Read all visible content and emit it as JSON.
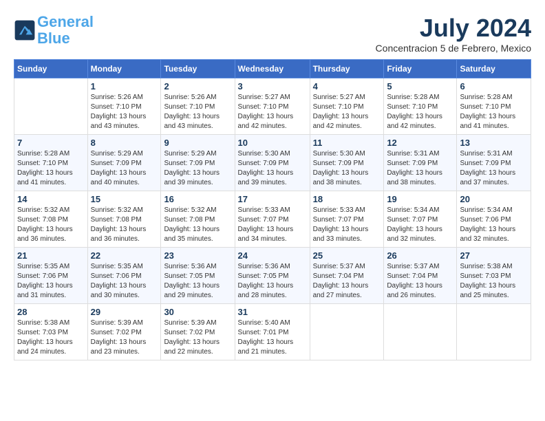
{
  "header": {
    "logo_line1": "General",
    "logo_line2": "Blue",
    "month": "July 2024",
    "location": "Concentracion 5 de Febrero, Mexico"
  },
  "days_of_week": [
    "Sunday",
    "Monday",
    "Tuesday",
    "Wednesday",
    "Thursday",
    "Friday",
    "Saturday"
  ],
  "weeks": [
    [
      {
        "day": "",
        "info": ""
      },
      {
        "day": "1",
        "info": "Sunrise: 5:26 AM\nSunset: 7:10 PM\nDaylight: 13 hours\nand 43 minutes."
      },
      {
        "day": "2",
        "info": "Sunrise: 5:26 AM\nSunset: 7:10 PM\nDaylight: 13 hours\nand 43 minutes."
      },
      {
        "day": "3",
        "info": "Sunrise: 5:27 AM\nSunset: 7:10 PM\nDaylight: 13 hours\nand 42 minutes."
      },
      {
        "day": "4",
        "info": "Sunrise: 5:27 AM\nSunset: 7:10 PM\nDaylight: 13 hours\nand 42 minutes."
      },
      {
        "day": "5",
        "info": "Sunrise: 5:28 AM\nSunset: 7:10 PM\nDaylight: 13 hours\nand 42 minutes."
      },
      {
        "day": "6",
        "info": "Sunrise: 5:28 AM\nSunset: 7:10 PM\nDaylight: 13 hours\nand 41 minutes."
      }
    ],
    [
      {
        "day": "7",
        "info": "Sunrise: 5:28 AM\nSunset: 7:10 PM\nDaylight: 13 hours\nand 41 minutes."
      },
      {
        "day": "8",
        "info": "Sunrise: 5:29 AM\nSunset: 7:09 PM\nDaylight: 13 hours\nand 40 minutes."
      },
      {
        "day": "9",
        "info": "Sunrise: 5:29 AM\nSunset: 7:09 PM\nDaylight: 13 hours\nand 39 minutes."
      },
      {
        "day": "10",
        "info": "Sunrise: 5:30 AM\nSunset: 7:09 PM\nDaylight: 13 hours\nand 39 minutes."
      },
      {
        "day": "11",
        "info": "Sunrise: 5:30 AM\nSunset: 7:09 PM\nDaylight: 13 hours\nand 38 minutes."
      },
      {
        "day": "12",
        "info": "Sunrise: 5:31 AM\nSunset: 7:09 PM\nDaylight: 13 hours\nand 38 minutes."
      },
      {
        "day": "13",
        "info": "Sunrise: 5:31 AM\nSunset: 7:09 PM\nDaylight: 13 hours\nand 37 minutes."
      }
    ],
    [
      {
        "day": "14",
        "info": "Sunrise: 5:32 AM\nSunset: 7:08 PM\nDaylight: 13 hours\nand 36 minutes."
      },
      {
        "day": "15",
        "info": "Sunrise: 5:32 AM\nSunset: 7:08 PM\nDaylight: 13 hours\nand 36 minutes."
      },
      {
        "day": "16",
        "info": "Sunrise: 5:32 AM\nSunset: 7:08 PM\nDaylight: 13 hours\nand 35 minutes."
      },
      {
        "day": "17",
        "info": "Sunrise: 5:33 AM\nSunset: 7:07 PM\nDaylight: 13 hours\nand 34 minutes."
      },
      {
        "day": "18",
        "info": "Sunrise: 5:33 AM\nSunset: 7:07 PM\nDaylight: 13 hours\nand 33 minutes."
      },
      {
        "day": "19",
        "info": "Sunrise: 5:34 AM\nSunset: 7:07 PM\nDaylight: 13 hours\nand 32 minutes."
      },
      {
        "day": "20",
        "info": "Sunrise: 5:34 AM\nSunset: 7:06 PM\nDaylight: 13 hours\nand 32 minutes."
      }
    ],
    [
      {
        "day": "21",
        "info": "Sunrise: 5:35 AM\nSunset: 7:06 PM\nDaylight: 13 hours\nand 31 minutes."
      },
      {
        "day": "22",
        "info": "Sunrise: 5:35 AM\nSunset: 7:06 PM\nDaylight: 13 hours\nand 30 minutes."
      },
      {
        "day": "23",
        "info": "Sunrise: 5:36 AM\nSunset: 7:05 PM\nDaylight: 13 hours\nand 29 minutes."
      },
      {
        "day": "24",
        "info": "Sunrise: 5:36 AM\nSunset: 7:05 PM\nDaylight: 13 hours\nand 28 minutes."
      },
      {
        "day": "25",
        "info": "Sunrise: 5:37 AM\nSunset: 7:04 PM\nDaylight: 13 hours\nand 27 minutes."
      },
      {
        "day": "26",
        "info": "Sunrise: 5:37 AM\nSunset: 7:04 PM\nDaylight: 13 hours\nand 26 minutes."
      },
      {
        "day": "27",
        "info": "Sunrise: 5:38 AM\nSunset: 7:03 PM\nDaylight: 13 hours\nand 25 minutes."
      }
    ],
    [
      {
        "day": "28",
        "info": "Sunrise: 5:38 AM\nSunset: 7:03 PM\nDaylight: 13 hours\nand 24 minutes."
      },
      {
        "day": "29",
        "info": "Sunrise: 5:39 AM\nSunset: 7:02 PM\nDaylight: 13 hours\nand 23 minutes."
      },
      {
        "day": "30",
        "info": "Sunrise: 5:39 AM\nSunset: 7:02 PM\nDaylight: 13 hours\nand 22 minutes."
      },
      {
        "day": "31",
        "info": "Sunrise: 5:40 AM\nSunset: 7:01 PM\nDaylight: 13 hours\nand 21 minutes."
      },
      {
        "day": "",
        "info": ""
      },
      {
        "day": "",
        "info": ""
      },
      {
        "day": "",
        "info": ""
      }
    ]
  ]
}
